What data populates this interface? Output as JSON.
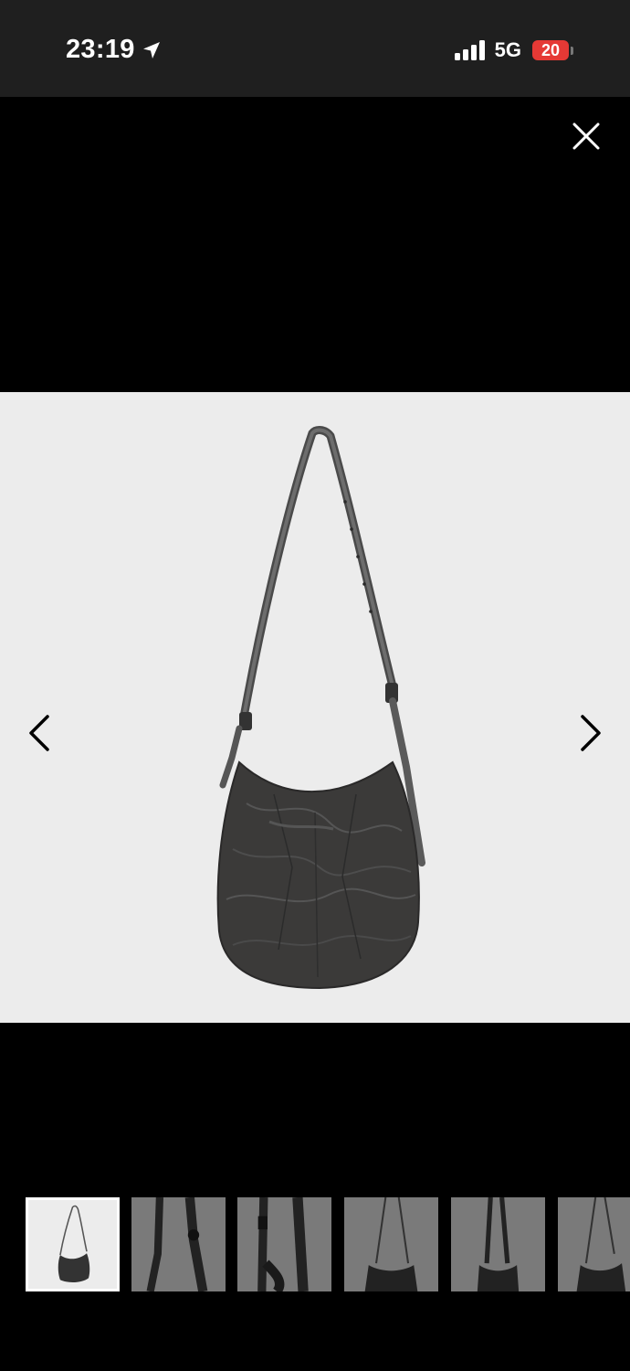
{
  "status_bar": {
    "time": "23:19",
    "network": "5G",
    "battery": "20",
    "battery_color": "#e53935"
  },
  "viewer": {
    "close_icon": "close-icon",
    "prev_icon": "chevron-left-icon",
    "next_icon": "chevron-right-icon",
    "background": "#000000",
    "image_background": "#ececec"
  },
  "thumbnails": [
    {
      "name": "thumbnail-1",
      "active": true
    },
    {
      "name": "thumbnail-2",
      "active": false
    },
    {
      "name": "thumbnail-3",
      "active": false
    },
    {
      "name": "thumbnail-4",
      "active": false
    },
    {
      "name": "thumbnail-5",
      "active": false
    },
    {
      "name": "thumbnail-6",
      "active": false
    }
  ]
}
